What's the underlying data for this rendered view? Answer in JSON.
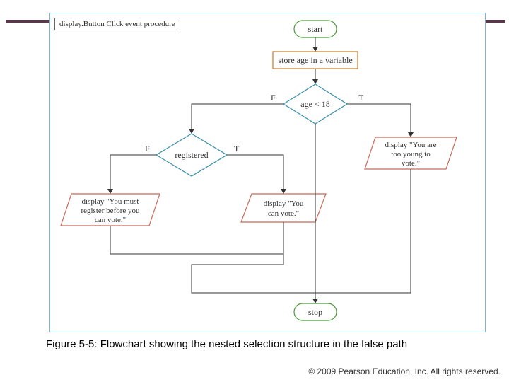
{
  "accent_color": "#5a3a4a",
  "procedure_label": "display.Button Click event procedure",
  "flowchart": {
    "start": "start",
    "store_age": "store age in a variable",
    "decision_age": "age < 18",
    "decision_registered": "registered",
    "display_too_young_l1": "display \"You are",
    "display_too_young_l2": "too young to",
    "display_too_young_l3": "vote.\"",
    "display_can_vote_l1": "display \"You",
    "display_can_vote_l2": "can vote.\"",
    "display_must_register_l1": "display \"You must",
    "display_must_register_l2": "register before you",
    "display_must_register_l3": "can vote.\"",
    "label_true": "T",
    "label_false": "F",
    "stop": "stop"
  },
  "caption": "Figure 5-5: Flowchart showing the nested selection structure in the false path",
  "copyright": "© 2009 Pearson Education, Inc.  All rights reserved."
}
